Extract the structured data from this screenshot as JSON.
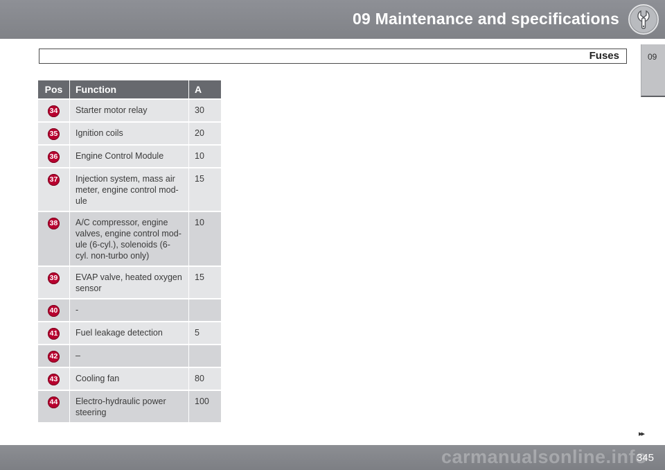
{
  "header": {
    "chapter_title": "09 Maintenance and specifications",
    "section_title": "Fuses",
    "chapter_tab": "09",
    "icon": "wrench-icon"
  },
  "table": {
    "headers": {
      "pos": "Pos",
      "function": "Function",
      "amps": "A"
    },
    "rows": [
      {
        "pos": "34",
        "function": "Starter motor relay",
        "amps": "30"
      },
      {
        "pos": "35",
        "function": "Ignition coils",
        "amps": "20"
      },
      {
        "pos": "36",
        "function": "Engine Control Module",
        "amps": "10"
      },
      {
        "pos": "37",
        "function": "Injection system, mass air meter, engine control mod-ule",
        "amps": "15"
      },
      {
        "pos": "38",
        "function": "A/C compressor, engine valves, engine control mod-ule (6-cyl.), solenoids (6-cyl. non-turbo only)",
        "amps": "10"
      },
      {
        "pos": "39",
        "function": "EVAP valve, heated oxygen sensor",
        "amps": "15"
      },
      {
        "pos": "40",
        "function": "-",
        "amps": ""
      },
      {
        "pos": "41",
        "function": "Fuel leakage detection",
        "amps": "5"
      },
      {
        "pos": "42",
        "function": "–",
        "amps": ""
      },
      {
        "pos": "43",
        "function": "Cooling fan",
        "amps": "80"
      },
      {
        "pos": "44",
        "function": "Electro-hydraulic power steering",
        "amps": "100"
      }
    ],
    "badge_color": "#b8002f"
  },
  "footer": {
    "continue_arrows": "▸▸",
    "page_number": "345",
    "watermark": "carmanualsonline.info"
  }
}
